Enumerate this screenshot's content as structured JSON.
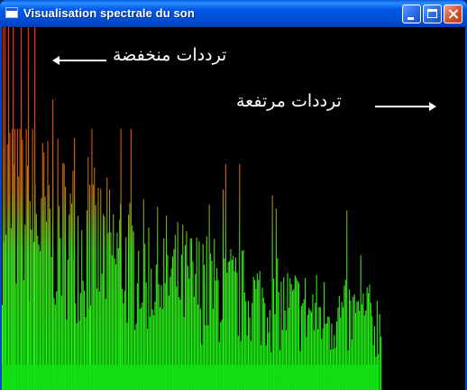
{
  "window": {
    "title": "Visualisation spectrale du son",
    "icon": "app-window-icon",
    "buttons": {
      "minimize_icon": "minimize-icon",
      "maximize_icon": "maximize-icon",
      "close_icon": "close-icon"
    }
  },
  "annotations": {
    "low_frequencies": "ترددات منخفضة",
    "high_frequencies": "ترددات مرتفعة"
  },
  "colors": {
    "titlebar": "#0058e6",
    "background": "#000000",
    "low_color": "#ff2000",
    "high_color": "#10ff10",
    "close_button": "#d9542e"
  }
}
